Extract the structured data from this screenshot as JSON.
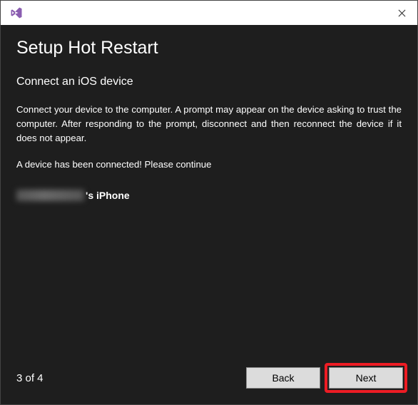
{
  "titlebar": {
    "icon_name": "visual-studio-icon"
  },
  "dialog": {
    "title": "Setup Hot Restart",
    "subtitle": "Connect an iOS device",
    "instructions": "Connect your device to the computer. A prompt may appear on the device asking to trust the computer. After responding to the prompt, disconnect and then reconnect the device if it does not appear.",
    "status": "A device has been connected! Please continue",
    "device_name_suffix": "'s iPhone"
  },
  "footer": {
    "page_counter": "3 of 4",
    "back_label": "Back",
    "next_label": "Next"
  }
}
